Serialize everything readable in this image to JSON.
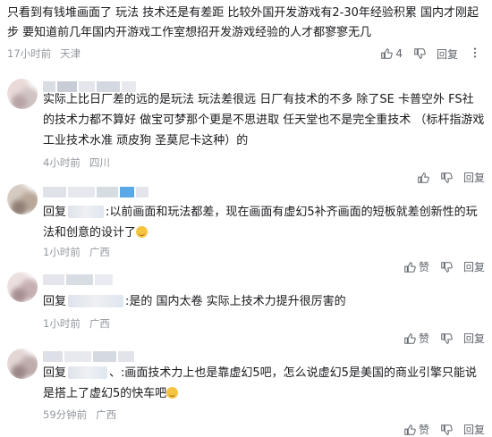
{
  "top": {
    "text": "只看到有钱堆画面了 玩法 技术还是有差距 比较外国开发游戏有2-30年经验积累 国内才刚起步 要知道前几年国内开游戏工作室想招开发游戏经验的人才都寥寥无几",
    "time": "17小时前",
    "location": "天津",
    "likes": "4",
    "reply_label": "回复"
  },
  "replies": [
    {
      "prefix": "",
      "text": "实际上比日厂差的远的是玩法 玩法差很远 日厂有技术的不多 除了SE 卡普空外 FS社的技术力都不算好 做宝可梦那个更是不思进取 任天堂也不是完全重技术 （标杆指游戏工业技术水准 顽皮狗 圣莫尼卡这种）的",
      "time": "4小时前",
      "location": "四川",
      "like_label": "",
      "reply_label": "回复",
      "has_emoji": false
    },
    {
      "prefix": "回复",
      "text": ":以前画面和玩法都差，现在画面有虚幻5补齐画面的短板就差创新性的玩法和创意的设计了",
      "time": "1小时前",
      "location": "广西",
      "like_label": "赞",
      "reply_label": "回复",
      "has_emoji": true
    },
    {
      "prefix": "回复",
      "text": ":是的 国内太卷 实际上技术力提升很厉害的",
      "time": "1小时前",
      "location": "广西",
      "like_label": "赞",
      "reply_label": "回复",
      "has_emoji": false
    },
    {
      "prefix": "回复",
      "text": "、:画面技术力上也是靠虚幻5吧，怎么说虚幻5是美国的商业引擎只能说是搭上了虚幻5的快车吧",
      "time": "59分钟前",
      "location": "广西",
      "like_label": "赞",
      "reply_label": "回复",
      "has_emoji": true
    }
  ],
  "icons": {
    "like": "thumb-up-icon",
    "dislike": "thumb-down-icon",
    "more": "more-dots-icon"
  },
  "colors": {
    "text": "#18191c",
    "meta": "#9499a0",
    "action": "#61666d"
  }
}
